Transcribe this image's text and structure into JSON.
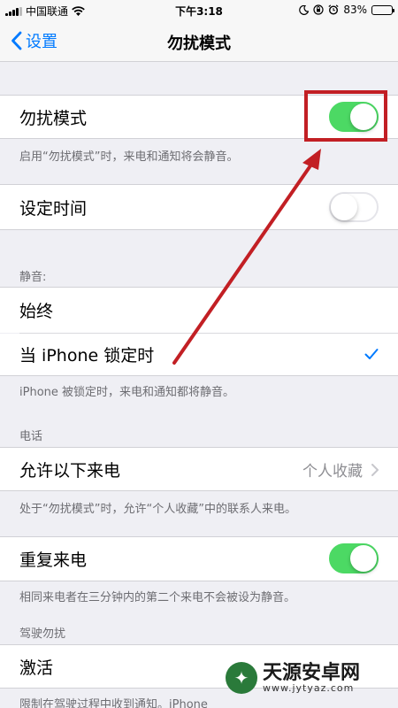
{
  "status_bar": {
    "carrier": "中国联通",
    "time": "下午3:18",
    "battery_percent": "83%",
    "battery_level": 0.83,
    "icons": [
      "signal-icon",
      "wifi-icon",
      "moon-icon",
      "orientation-lock-icon",
      "alarm-icon",
      "battery-icon"
    ]
  },
  "nav": {
    "back_label": "设置",
    "title": "勿扰模式"
  },
  "dnd": {
    "label": "勿扰模式",
    "enabled": true,
    "note": "启用“勿扰模式”时，来电和通知将会静音。"
  },
  "scheduled": {
    "label": "设定时间",
    "enabled": false
  },
  "silence": {
    "header": "静音:",
    "always_label": "始终",
    "locked_label": "当 iPhone 锁定时",
    "selected": "locked",
    "note": "iPhone 被锁定时，来电和通知都将静音。"
  },
  "phone": {
    "header": "电话",
    "allow_calls_label": "允许以下来电",
    "allow_calls_value": "个人收藏",
    "note": "处于“勿扰模式”时，允许“个人收藏”中的联系人来电。",
    "repeated_label": "重复来电",
    "repeated_enabled": true,
    "repeated_note": "相同来电者在三分钟内的第二个来电不会被设为静音。"
  },
  "driving": {
    "header": "驾驶勿扰",
    "activate_label": "激活",
    "note": "限制在驾驶过程中收到通知。iPhone"
  },
  "colors": {
    "accent": "#007aff",
    "toggle_on": "#4cd964",
    "highlight": "#c21f24"
  },
  "watermark": {
    "title": "天源安卓网",
    "url": "www.jytyaz.com"
  }
}
